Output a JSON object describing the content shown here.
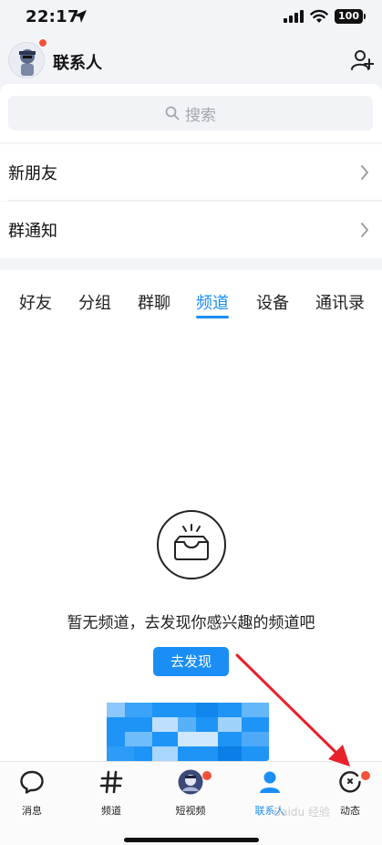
{
  "status_bar": {
    "time": "22:17",
    "battery": "100"
  },
  "header": {
    "title": "联系人"
  },
  "search": {
    "placeholder": "搜索"
  },
  "rows": [
    {
      "label": "新朋友"
    },
    {
      "label": "群通知"
    }
  ],
  "tabs": [
    {
      "label": "好友",
      "active": false
    },
    {
      "label": "分组",
      "active": false
    },
    {
      "label": "群聊",
      "active": false
    },
    {
      "label": "频道",
      "active": true
    },
    {
      "label": "设备",
      "active": false
    },
    {
      "label": "通讯录",
      "active": false
    }
  ],
  "empty_state": {
    "message": "暂无频道，去发现你感兴趣的频道吧",
    "button_label": "去发现"
  },
  "bottom_nav": [
    {
      "label": "消息",
      "icon": "chat-bubble-icon",
      "active": false
    },
    {
      "label": "频道",
      "icon": "hashtag-icon",
      "active": false
    },
    {
      "label": "短视频",
      "icon": "avatar-video-icon",
      "active": false
    },
    {
      "label": "联系人",
      "icon": "person-icon",
      "active": true
    },
    {
      "label": "动态",
      "icon": "refresh-circle-icon",
      "active": false
    }
  ],
  "colors": {
    "accent": "#1a8ef5",
    "badge": "#f4523b",
    "arrow": "#e8202a"
  },
  "watermark": "Baidu 经验"
}
